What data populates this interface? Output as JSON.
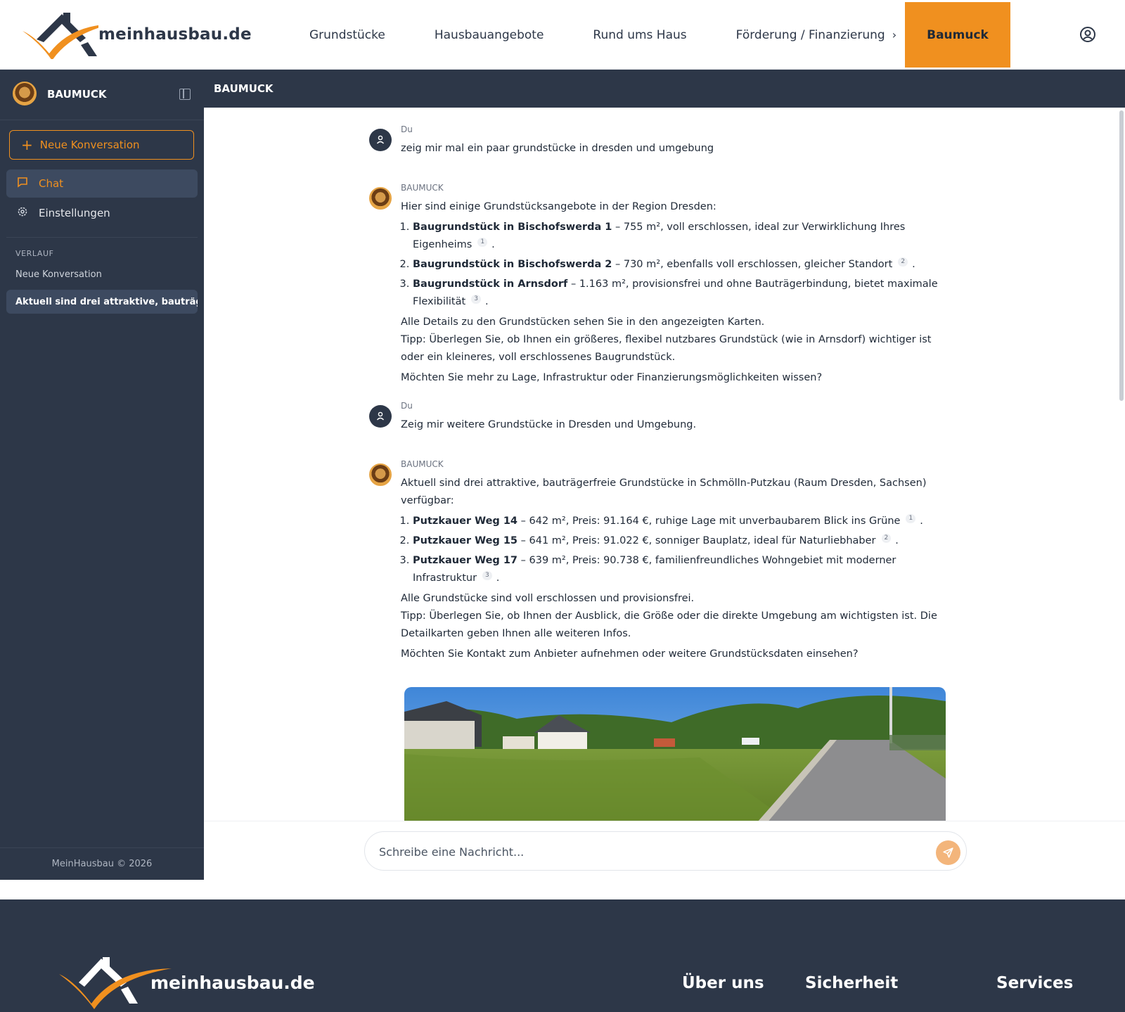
{
  "header": {
    "logo_text": "meinhausbau.de",
    "nav": [
      "Grundstücke",
      "Hausbauangebote",
      "Rund ums Haus",
      "Förderung / Finanzierung"
    ],
    "active": "Baumuck"
  },
  "sidebar": {
    "title": "BAUMUCK",
    "new_conversation": "Neue Konversation",
    "items": [
      {
        "label": "Chat"
      },
      {
        "label": "Einstellungen"
      }
    ],
    "section": "VERLAUF",
    "history": [
      "Neue Konversation",
      "Aktuell sind drei attraktive, bauträgerf..."
    ],
    "footer": "MeinHausbau © 2026"
  },
  "chat": {
    "title": "BAUMUCK",
    "messages": [
      {
        "author": "Du",
        "text": "zeig mir mal ein paar grundstücke in dresden und umgebung"
      },
      {
        "author": "BAUMUCK",
        "intro": "Hier sind einige Grundstücksangebote in der Region Dresden:",
        "items": [
          {
            "title": "Baugrundstück in Bischofswerda 1",
            "desc": " – 755 m², voll erschlossen, ideal zur Verwirklichung Ihres Eigenheims",
            "ref": "1"
          },
          {
            "title": "Baugrundstück in Bischofswerda 2",
            "desc": " – 730 m², ebenfalls voll erschlossen, gleicher Standort",
            "ref": "2"
          },
          {
            "title": "Baugrundstück in Arnsdorf",
            "desc": " – 1.163 m², provisionsfrei und ohne Bauträgerbindung, bietet maximale Flexibilität",
            "ref": "3"
          }
        ],
        "para1": "Alle Details zu den Grundstücken sehen Sie in den angezeigten Karten.",
        "para2": "Tipp: Überlegen Sie, ob Ihnen ein größeres, flexibel nutzbares Grundstück (wie in Arnsdorf) wichtiger ist oder ein kleineres, voll erschlossenes Baugrundstück.",
        "para3": "Möchten Sie mehr zu Lage, Infrastruktur oder Finanzierungsmöglichkeiten wissen?"
      },
      {
        "author": "Du",
        "text": "Zeig mir weitere Grundstücke in Dresden und Umgebung."
      },
      {
        "author": "BAUMUCK",
        "intro": "Aktuell sind drei attraktive, bauträgerfreie Grundstücke in Schmölln-Putzkau (Raum Dresden, Sachsen) verfügbar:",
        "items": [
          {
            "title": "Putzkauer Weg 14",
            "desc": " – 642 m², Preis: 91.164 €, ruhige Lage mit unverbaubarem Blick ins Grüne",
            "ref": "1"
          },
          {
            "title": "Putzkauer Weg 15",
            "desc": " – 641 m², Preis: 91.022 €, sonniger Bauplatz, ideal für Naturliebhaber",
            "ref": "2"
          },
          {
            "title": "Putzkauer Weg 17",
            "desc": " – 639 m², Preis: 90.738 €, familienfreundliches Wohngebiet mit moderner Infrastruktur",
            "ref": "3"
          }
        ],
        "para1": "Alle Grundstücke sind voll erschlossen und provisionsfrei.",
        "para2": "Tipp: Überlegen Sie, ob Ihnen der Ausblick, die Größe oder die direkte Umgebung am wichtigsten ist. Die Detailkarten geben Ihnen alle weiteren Infos.",
        "para3": "Möchten Sie Kontakt zum Anbieter aufnehmen oder weitere Grundstücksdaten einsehen?"
      }
    ],
    "input_placeholder": "Schreibe eine Nachricht..."
  },
  "footer": {
    "logo_text": "meinhausbau.de",
    "links": [
      "Über uns",
      "Sicherheit",
      "Services"
    ]
  },
  "colors": {
    "accent": "#f0901f",
    "dark": "#2d3748"
  }
}
